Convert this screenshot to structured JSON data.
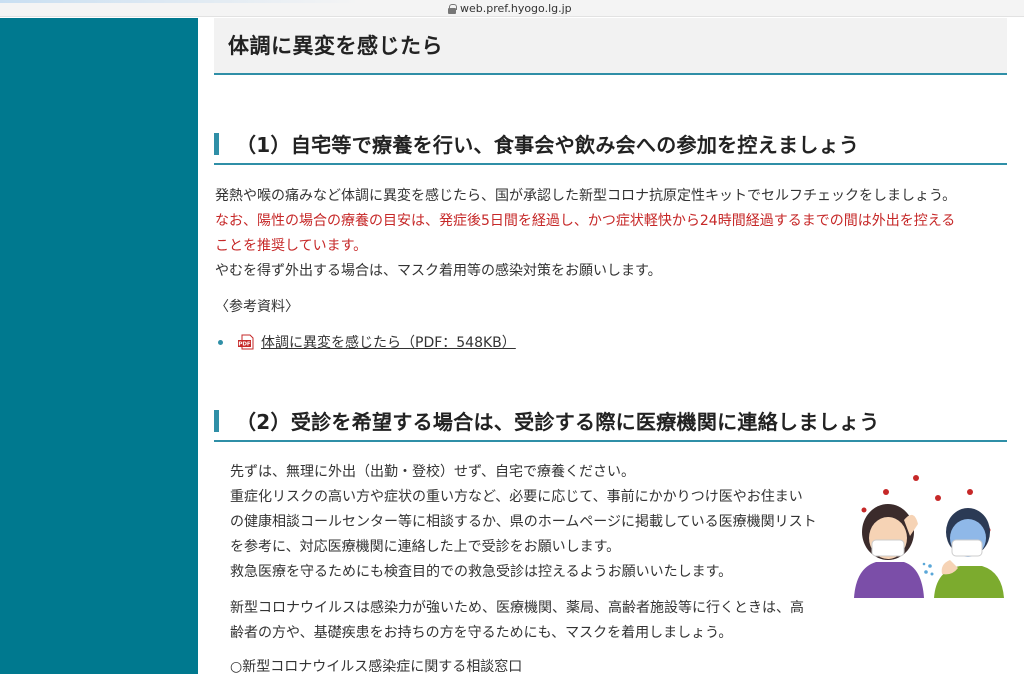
{
  "browser": {
    "url": "web.pref.hyogo.lg.jp"
  },
  "page": {
    "title": "体調に異変を感じたら"
  },
  "section1": {
    "heading": "（1）自宅等で療養を行い、食事会や飲み会への参加を控えましょう",
    "line1": "発熱や喉の痛みなど体調に異変を感じたら、国が承認した新型コロナ抗原定性キットでセルフチェックをしましょう。",
    "red_line1": "なお、陽性の場合の療養の目安は、発症後5日間を経過し、かつ症状軽快から24時間経過するまでの間は外出を控える",
    "red_line2": "ことを推奨しています。",
    "line4": "やむを得ず外出する場合は、マスク着用等の感染対策をお願いします。",
    "reference_label": "〈参考資料〉",
    "pdf_link": "体調に異変を感じたら（PDF：548KB）"
  },
  "section2": {
    "heading": "（2）受診を希望する場合は、受診する際に医療機関に連絡しましょう",
    "p1_line1": "先ずは、無理に外出（出勤・登校）せず、自宅で療養ください。",
    "p1_line2": "重症化リスクの高い方や症状の重い方など、必要に応じて、事前にかかりつけ医やお住まい",
    "p1_line3": "の健康相談コールセンター等に相談するか、県のホームページに掲載している医療機関リスト",
    "p1_line4": "を参考に、対応医療機関に連絡した上で受診をお願いします。",
    "p1_line5": "救急医療を守るためにも検査目的での救急受診は控えるようお願いいたします。",
    "p2_line1": "新型コロナウイルスは感染力が強いため、医療機関、薬局、高齢者施設等に行くときは、高",
    "p2_line2": "齢者の方や、基礎疾患をお持ちの方を守るためにも、マスクを着用しましょう。",
    "consult": "○新型コロナウイルス感染症に関する相談窓口"
  },
  "colors": {
    "sidebar": "#00798f",
    "accent": "#2f8fa7",
    "warning_text": "#c62828"
  },
  "icons": {
    "pdf": "pdf-icon",
    "lock": "lock-icon",
    "illustration": "masked-people-coughing-illustration"
  }
}
